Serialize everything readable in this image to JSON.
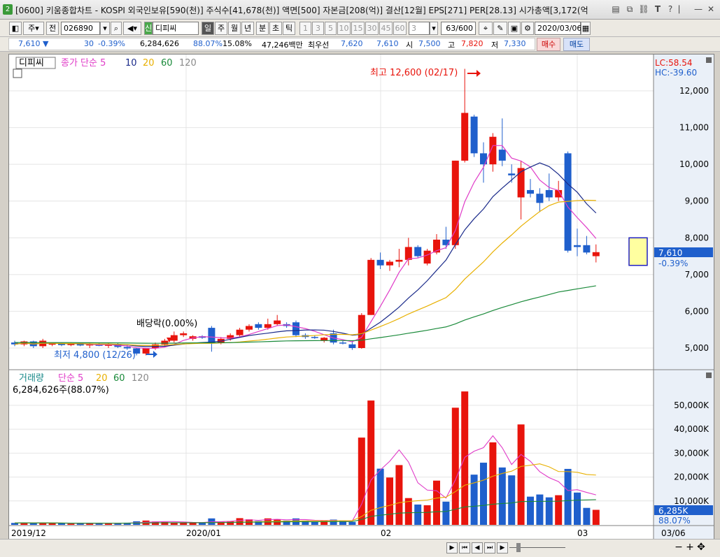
{
  "window": {
    "badge": "2",
    "title": "[0600] 키움종합차트 - KOSPI 외국인보유[590(천)] 주식수[41,678(천)] 액면[500] 자본금[208(억)] 결산[12월] EPS[271] PER[28.13] 시가총액[3,172(억"
  },
  "toolbar": {
    "market": "주",
    "prev_label": "전",
    "code": "026890",
    "stock_badge": "신",
    "stock_name": "디피씨",
    "periods": [
      "일",
      "주",
      "월",
      "년",
      "분",
      "초",
      "틱"
    ],
    "intervals": [
      "1",
      "3",
      "5",
      "10",
      "15",
      "30",
      "45",
      "60"
    ],
    "interval_value": "3",
    "count": "63",
    "count_max": "/600",
    "date": "2020/03/06"
  },
  "quote": {
    "price": "7,610",
    "change": "30",
    "change_pct": "-0.39%",
    "volume": "6,284,626",
    "vol_ratio": "88.07%",
    "turnover": "15.08%",
    "amount": "47,246백만",
    "best_label": "최우선",
    "best_sell": "7,620",
    "best_buy": "7,610",
    "open_label": "시",
    "open": "7,500",
    "high_label": "고",
    "high": "7,820",
    "low_label": "저",
    "low": "7,330",
    "buy_button": "매수",
    "sell_button": "매도"
  },
  "price_panel": {
    "name": "디피씨",
    "legend": [
      "종가 단순 5",
      "10",
      "20",
      "60",
      "120"
    ],
    "lc_label": "LC:58.54",
    "hc_label": "HC:-39.60",
    "dividend_label": "배당락(0.00%)",
    "high_annotation": "최고 12,600 (02/17)",
    "low_annotation": "최저 4,800 (12/26)",
    "current_price_label": "7,610",
    "current_change_label": "-0.39%"
  },
  "volume_panel": {
    "legend": [
      "거래량",
      "단순 5",
      "20",
      "60",
      "120"
    ],
    "value_label": "6,284,626주(88.07%)",
    "current_volume_label": "6,285K",
    "current_ratio_label": "88.07%"
  },
  "x_axis": {
    "labels": [
      "2019/12",
      "2020/01",
      "02",
      "03"
    ],
    "right_label": "03/06"
  },
  "colors": {
    "up": "#e8140c",
    "down": "#1f5fcc",
    "ma5": "#e03cc8",
    "ma10": "#1a2a8a",
    "ma20": "#e8b000",
    "ma60": "#1a8a3a",
    "ma120": "#8a8a8a"
  },
  "chart_data": {
    "type": "candlestick",
    "y_range": [
      4600,
      12800
    ],
    "y_ticks": [
      "5,000",
      "6,000",
      "7,000",
      "8,000",
      "9,000",
      "10,000",
      "11,000",
      "12,000"
    ],
    "volume_y_ticks": [
      "10,000K",
      "20,000K",
      "30,000K",
      "40,000K",
      "50,000K"
    ],
    "volume_range_k": [
      0,
      57000
    ],
    "candles": [
      [
        5150,
        5200,
        5050,
        5100
      ],
      [
        5100,
        5200,
        5050,
        5180
      ],
      [
        5180,
        5200,
        5000,
        5050
      ],
      [
        5050,
        5250,
        5000,
        5200
      ],
      [
        5100,
        5150,
        5050,
        5120
      ],
      [
        5120,
        5150,
        5050,
        5080
      ],
      [
        5080,
        5150,
        5050,
        5130
      ],
      [
        5130,
        5150,
        5050,
        5070
      ],
      [
        5070,
        5150,
        5000,
        5100
      ],
      [
        5100,
        5150,
        5050,
        5060
      ],
      [
        5060,
        5150,
        5000,
        5110
      ],
      [
        5110,
        5150,
        5000,
        5030
      ],
      [
        5030,
        5100,
        4950,
        4990
      ],
      [
        4990,
        5000,
        4800,
        4850
      ],
      [
        4850,
        5000,
        4800,
        4990
      ],
      [
        4990,
        5150,
        4950,
        5100
      ],
      [
        5100,
        5250,
        5050,
        5200
      ],
      [
        5200,
        5450,
        5150,
        5350
      ],
      [
        5350,
        5450,
        5300,
        5400
      ],
      [
        5250,
        5350,
        5200,
        5320
      ],
      [
        5320,
        5350,
        5250,
        5280
      ],
      [
        5550,
        5600,
        4900,
        5150
      ],
      [
        5150,
        5300,
        5100,
        5250
      ],
      [
        5250,
        5400,
        5200,
        5350
      ],
      [
        5350,
        5550,
        5300,
        5500
      ],
      [
        5500,
        5650,
        5450,
        5600
      ],
      [
        5650,
        5700,
        5500,
        5550
      ],
      [
        5550,
        5800,
        5500,
        5650
      ],
      [
        5650,
        5900,
        5600,
        5750
      ],
      [
        5650,
        5700,
        5550,
        5600
      ],
      [
        5700,
        5750,
        5300,
        5350
      ],
      [
        5350,
        5400,
        5250,
        5300
      ],
      [
        5300,
        5350,
        5250,
        5280
      ],
      [
        5200,
        5300,
        5150,
        5280
      ],
      [
        5400,
        5500,
        5100,
        5150
      ],
      [
        5150,
        5200,
        5100,
        5130
      ],
      [
        5100,
        5200,
        4950,
        5000
      ],
      [
        5000,
        5950,
        4980,
        5900
      ],
      [
        5900,
        7450,
        5900,
        7400
      ],
      [
        7400,
        7600,
        7150,
        7250
      ],
      [
        7250,
        7400,
        7100,
        7350
      ],
      [
        7350,
        7700,
        7200,
        7400
      ],
      [
        7400,
        8000,
        7250,
        7750
      ],
      [
        7750,
        7800,
        7450,
        7500
      ],
      [
        7300,
        7700,
        7250,
        7650
      ],
      [
        7600,
        8100,
        7550,
        7950
      ],
      [
        7950,
        8300,
        7700,
        7800
      ],
      [
        7800,
        10100,
        7700,
        10100
      ],
      [
        10100,
        12600,
        10050,
        11400
      ],
      [
        11300,
        11350,
        10200,
        10300
      ],
      [
        10300,
        10600,
        9500,
        10000
      ],
      [
        10000,
        10850,
        9800,
        10750
      ],
      [
        10400,
        11250,
        9950,
        10100
      ],
      [
        9750,
        10000,
        9500,
        9700
      ],
      [
        9100,
        10100,
        8500,
        9900
      ],
      [
        9300,
        9600,
        9100,
        9200
      ],
      [
        9200,
        9350,
        8700,
        8950
      ],
      [
        9300,
        9750,
        9000,
        9100
      ],
      [
        9100,
        9550,
        9000,
        9300
      ],
      [
        10300,
        10350,
        7600,
        7650
      ],
      [
        7800,
        8250,
        7500,
        7750
      ],
      [
        7800,
        8050,
        7550,
        7600
      ],
      [
        7500,
        7820,
        7330,
        7610
      ]
    ],
    "volume_k": [
      800,
      900,
      700,
      900,
      600,
      600,
      500,
      600,
      700,
      700,
      600,
      700,
      900,
      1500,
      1800,
      1400,
      1200,
      900,
      800,
      900,
      1000,
      2700,
      1300,
      1500,
      2800,
      2300,
      1600,
      2700,
      2200,
      1800,
      2700,
      1600,
      1300,
      1600,
      2200,
      1700,
      1200,
      36500,
      52000,
      23500,
      19800,
      25000,
      11200,
      8500,
      8200,
      18500,
      9700,
      49000,
      55800,
      21000,
      26000,
      34500,
      24000,
      20700,
      42000,
      11800,
      12700,
      11500,
      12400,
      23400,
      13500,
      7100,
      6285
    ],
    "projection_box": [
      7250,
      8000
    ],
    "x_labels": [
      "2019/12",
      "2020/01",
      "02",
      "03"
    ]
  }
}
